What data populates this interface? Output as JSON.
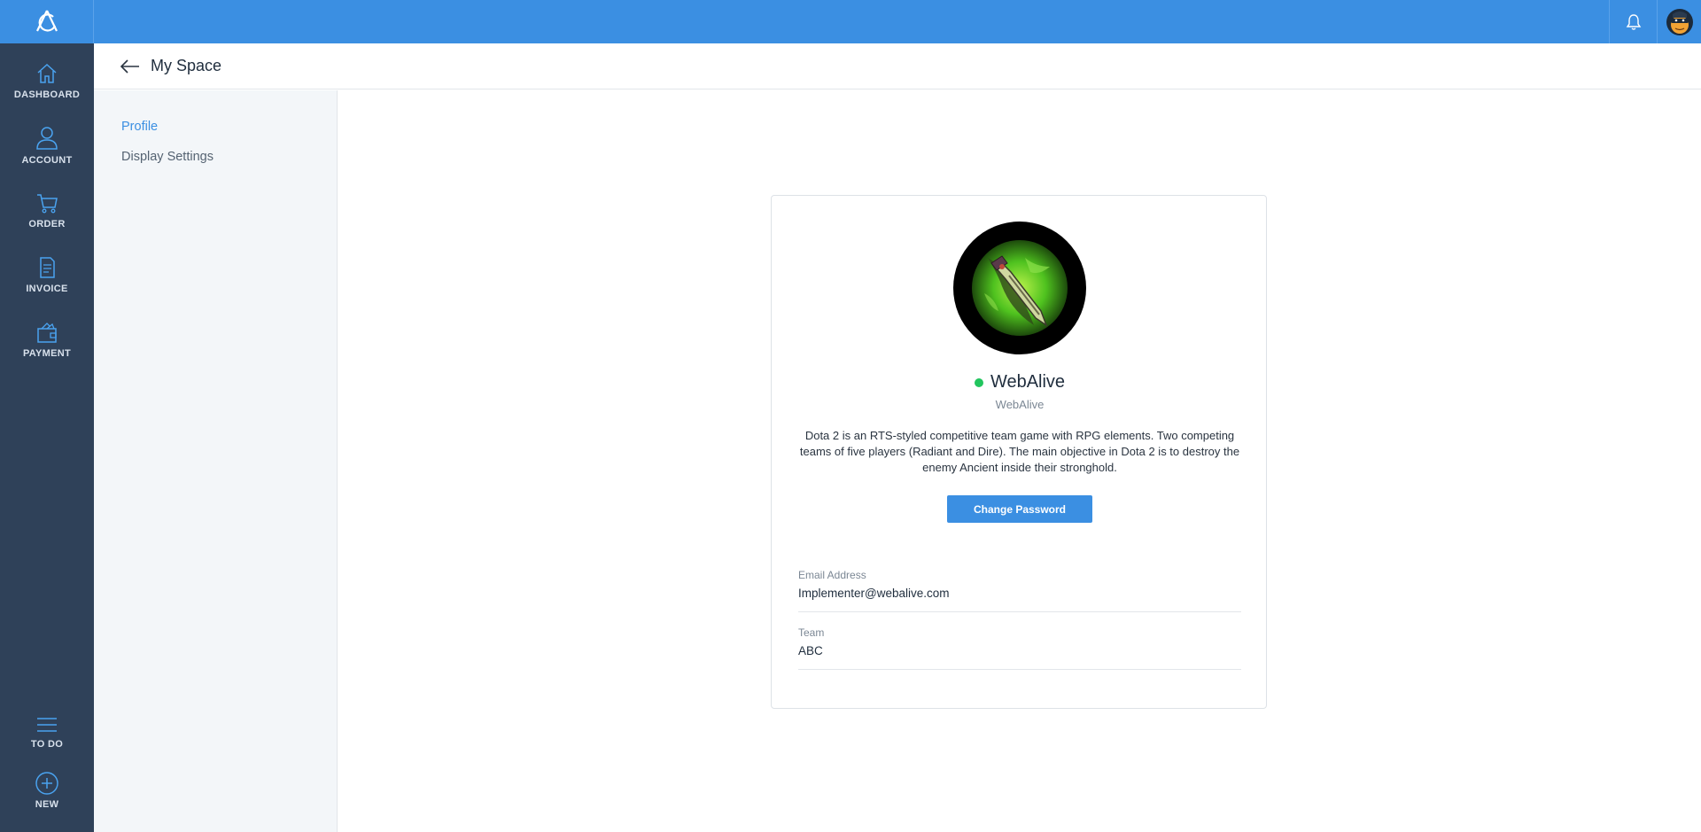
{
  "app": {
    "brand_icon": "app-logo",
    "notification_icon": "bell-icon",
    "user_avatar_icon": "user-avatar"
  },
  "leftnav": {
    "items": [
      {
        "label": "DASHBOARD",
        "icon": "home-icon"
      },
      {
        "label": "ACCOUNT",
        "icon": "user-icon"
      },
      {
        "label": "ORDER",
        "icon": "cart-icon"
      },
      {
        "label": "INVOICE",
        "icon": "document-icon"
      },
      {
        "label": "PAYMENT",
        "icon": "wallet-icon"
      }
    ],
    "bottom_items": [
      {
        "label": "TO DO",
        "icon": "menu-icon"
      },
      {
        "label": "NEW",
        "icon": "plus-circle-icon"
      }
    ]
  },
  "header": {
    "title": "My Space",
    "back_icon": "arrow-left-icon"
  },
  "subside": {
    "items": [
      {
        "label": "Profile",
        "active": true
      },
      {
        "label": "Display Settings",
        "active": false
      }
    ]
  },
  "profile": {
    "display_name": "WebAlive",
    "username": "WebAlive",
    "status": "online",
    "bio": "Dota 2 is an RTS-styled competitive team game with RPG elements. Two competing teams of five players (Radiant and Dire). The main objective in Dota 2 is to destroy the enemy Ancient inside their stronghold.",
    "change_password_label": "Change Password",
    "fields": [
      {
        "label": "Email Address",
        "value": "Implementer@webalive.com"
      },
      {
        "label": "Team",
        "value": "ABC"
      }
    ]
  },
  "colors": {
    "accent": "#3b8fe2",
    "nav_bg": "#2f4159",
    "status_online": "#22c55e"
  }
}
